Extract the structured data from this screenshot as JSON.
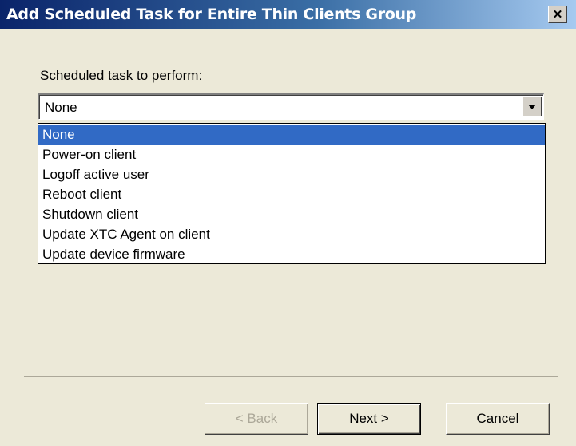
{
  "window": {
    "title": "Add Scheduled Task for Entire Thin Clients Group",
    "close_glyph": "✕"
  },
  "form": {
    "task_label": "Scheduled task to perform:",
    "selected_value": "None",
    "options": [
      "None",
      "Power-on client",
      "Logoff active user",
      "Reboot client",
      "Shutdown client",
      "Update XTC Agent on client",
      "Update device firmware"
    ],
    "highlighted_index": 0
  },
  "buttons": {
    "back_label": "< Back",
    "next_label": "Next >",
    "cancel_label": "Cancel"
  },
  "colors": {
    "title_bar_start": "#0a246a",
    "selection": "#316ac5",
    "dialog_bg": "#ece9d8"
  },
  "icons": {
    "close": "close-icon",
    "dropdown_arrow": "chevron-down-icon"
  }
}
